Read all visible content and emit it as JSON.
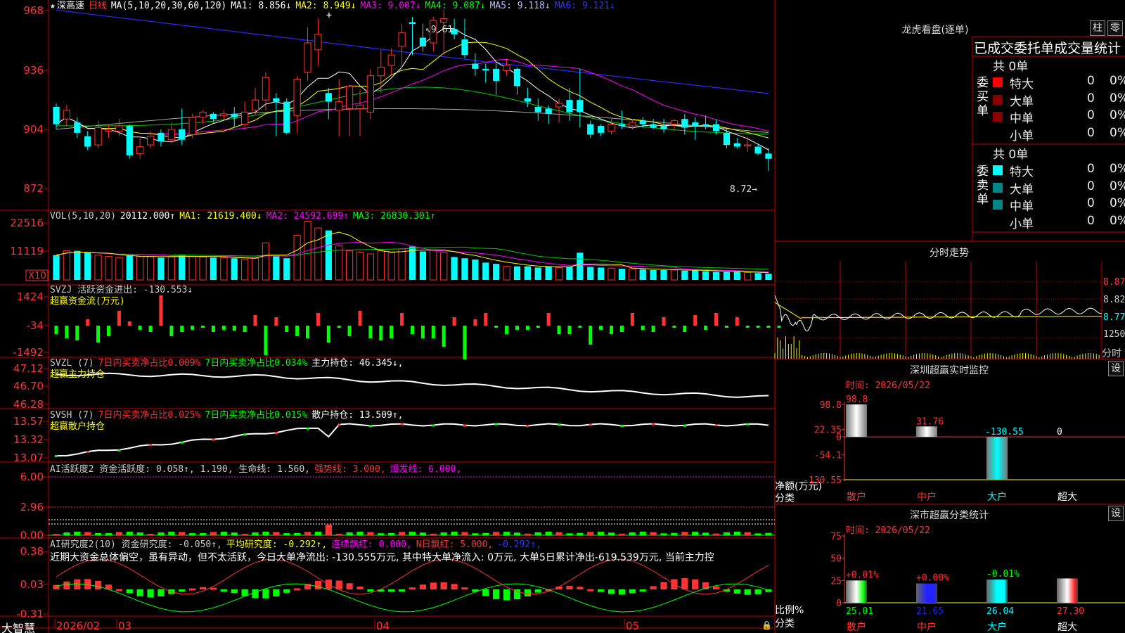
{
  "colors": {
    "up": "#ff3333",
    "down": "#00ffff",
    "grid": "#cc0000",
    "ma1": "#ffffff",
    "ma2": "#ffff00",
    "ma3": "#ff00ff",
    "ma4": "#00ff00",
    "ma5": "#8888ff",
    "ma6": "#3333ff",
    "axisText": "#ff3333",
    "yellow": "#ffff00",
    "green": "#00ff00",
    "white": "#ffffff",
    "cyan": "#00ffff"
  },
  "icons": {
    "star": "star-icon",
    "lock": "lock-icon"
  },
  "main": {
    "stock": "深高速",
    "period": "日线",
    "ma_label": "MA(5,10,20,30,60,120)",
    "ma1": "MA1: 8.856↓",
    "ma2": "MA2: 8.949↓",
    "ma3": "MA3: 9.007↓",
    "ma4": "MA4: 9.087↓",
    "ma5": "MA5: 9.118↓",
    "ma6": "MA6: 9.121↓",
    "high_label": "9.61",
    "low_label": "8.72",
    "yticks": [
      "968",
      "936",
      "904",
      "872"
    ]
  },
  "vol": {
    "label": "VOL(5,10,20)",
    "value": "20112.000↑",
    "ma1": "MA1: 21619.400↓",
    "ma2": "MA2: 24592.699↑",
    "ma3": "MA3: 26830.301↑",
    "yticks": [
      "22516",
      "11119"
    ],
    "unit": "X10"
  },
  "svzj": {
    "label": "SVZJ 活跃资金进出: -130.553↓",
    "sub": "超赢资金流(万元)",
    "yticks": [
      "1424",
      "-34",
      "-1492"
    ]
  },
  "svzl": {
    "label": "SVZL (7)",
    "p1": "7日内买卖净占比0.009%",
    "p2": "7日内买卖净占比0.034%",
    "p3": "主力持仓: 46.345↓,",
    "sub": "超赢主力持仓",
    "yticks": [
      "47.12",
      "46.70",
      "46.28"
    ]
  },
  "svsh": {
    "label": "SVSH (7)",
    "p1": "7日内买卖净占比0.025%",
    "p2": "7日内买卖净占比0.015%",
    "p3": "散户持仓: 13.509↑,",
    "sub": "超赢散户持仓",
    "yticks": [
      "13.57",
      "13.32",
      "13.07"
    ]
  },
  "ai1": {
    "label": "AI活跃度2 资金活跃度: 0.058↑, 1.190, 生命线: 1.560,",
    "p2": "强势线: 3.000,",
    "p3": "爆发线: 6.000,",
    "yticks": [
      "6.00",
      "2.96",
      "0.00"
    ]
  },
  "ai2": {
    "label": "AI研究度2(10) 资金研究度: -0.050↑,",
    "p2": "平均研究度: -0.292↑,",
    "p3": "连续飘红: 0.000,",
    "p4": "N日飘红: 5.000,",
    "p5": "-0.292↑,",
    "comment": "近期大资金总体偏空，虽有异动，但不太活跃，今日大单净流出: -130.555万元, 其中特大单净流入: 0万元, 大单5日累计净出-619.539万元, 当前主力控",
    "yticks": [
      "0.38",
      "0.03",
      "-0.31"
    ]
  },
  "bottom": {
    "brand": "大智慧",
    "dates": [
      "2026/02",
      "03",
      "04",
      "05"
    ]
  },
  "longhu": {
    "title": "龙虎看盘(逐单)",
    "btn1": "柱",
    "btn2": "零",
    "tabs": "已成交委托单成交量统计",
    "buy": {
      "side": "委买单",
      "total": "共 0单",
      "rows": [
        {
          "name": "特大",
          "v": "0",
          "p": "0%"
        },
        {
          "name": "大单",
          "v": "0",
          "p": "0%"
        },
        {
          "name": "中单",
          "v": "0",
          "p": "0%"
        },
        {
          "name": "小单",
          "v": "0",
          "p": "0%"
        }
      ]
    },
    "sell": {
      "side": "委卖单",
      "total": "共 0单",
      "rows": [
        {
          "name": "特大",
          "v": "0",
          "p": "0%"
        },
        {
          "name": "大单",
          "v": "0",
          "p": "0%"
        },
        {
          "name": "中单",
          "v": "0",
          "p": "0%"
        },
        {
          "name": "小单",
          "v": "0",
          "p": "0%"
        }
      ]
    }
  },
  "intraday": {
    "title": "分时走势",
    "yticks": [
      "8.87",
      "8.82",
      "8.77"
    ],
    "vol": "1250",
    "unit": "分时"
  },
  "monitor": {
    "title": "深圳超赢实时监控",
    "btn": "设",
    "date": "时间: 2026/05/22",
    "ylabel": "净额(万元)",
    "xlabel": "分类",
    "yticks": [
      "98.8",
      "22.35",
      "0",
      "-54.1",
      "-130.55"
    ],
    "chart_data": {
      "type": "bar",
      "categories": [
        "散户",
        "中户",
        "大户",
        "超大"
      ],
      "values": [
        98.8,
        31.76,
        -130.55,
        0
      ],
      "labels": [
        "98.8",
        "31.76",
        "-130.55",
        "0"
      ],
      "ylim": [
        -130.55,
        98.8
      ]
    }
  },
  "classify": {
    "title": "深市超赢分类统计",
    "btn": "设",
    "date": "时间: 2026/05/22",
    "ylabel": "比例%",
    "xlabel": "分类",
    "yticks": [
      "75",
      "50",
      "25",
      "0"
    ],
    "chart_data": {
      "type": "bar",
      "categories": [
        "散户",
        "中户",
        "大户",
        "超大"
      ],
      "values": [
        25.01,
        21.65,
        26.04,
        27.3
      ],
      "changes": [
        "+0.01%",
        "+0.00%",
        "-0.01%",
        ""
      ],
      "labels": [
        "25.01",
        "21.65",
        "26.04",
        "27.30"
      ],
      "ylim": [
        0,
        75
      ]
    }
  },
  "chart_data": {
    "type": "candlestick",
    "ylim": [
      8.62,
      9.71
    ],
    "candles": [
      [
        9.1,
        9.0,
        9.12,
        8.97
      ],
      [
        9.03,
        9.08,
        9.11,
        8.99
      ],
      [
        9.01,
        8.95,
        9.04,
        8.92
      ],
      [
        8.93,
        8.87,
        8.96,
        8.85
      ],
      [
        8.88,
        8.98,
        9.02,
        8.86
      ],
      [
        8.96,
        8.97,
        9.0,
        8.92
      ],
      [
        8.96,
        8.99,
        9.03,
        8.93
      ],
      [
        8.99,
        8.82,
        9.0,
        8.8
      ],
      [
        8.83,
        8.87,
        8.93,
        8.8
      ],
      [
        8.88,
        8.93,
        8.96,
        8.86
      ],
      [
        8.95,
        8.9,
        8.97,
        8.87
      ],
      [
        8.91,
        8.97,
        9.01,
        8.89
      ],
      [
        8.97,
        8.91,
        9.09,
        8.88
      ],
      [
        8.94,
        9.04,
        9.06,
        8.92
      ],
      [
        9.04,
        9.07,
        9.08,
        9.0
      ],
      [
        9.06,
        9.03,
        9.07,
        9.01
      ],
      [
        9.05,
        9.06,
        9.08,
        9.02
      ],
      [
        9.06,
        9.04,
        9.1,
        8.98
      ],
      [
        9.0,
        9.07,
        9.13,
        8.97
      ],
      [
        9.08,
        9.14,
        9.21,
        9.05
      ],
      [
        9.14,
        9.27,
        9.3,
        9.08
      ],
      [
        9.15,
        9.13,
        9.18,
        8.93
      ],
      [
        9.13,
        8.95,
        9.15,
        8.94
      ],
      [
        9.05,
        9.26,
        9.28,
        8.95
      ],
      [
        9.3,
        9.47,
        9.56,
        9.25
      ],
      [
        9.43,
        9.52,
        9.61,
        9.34
      ],
      [
        9.18,
        9.13,
        9.21,
        9.03
      ],
      [
        9.08,
        9.13,
        9.26,
        8.93
      ],
      [
        9.09,
        9.22,
        9.22,
        8.93
      ],
      [
        9.09,
        9.11,
        9.2,
        8.93
      ],
      [
        9.07,
        9.28,
        9.32,
        9.03
      ],
      [
        9.28,
        9.33,
        9.43,
        9.18
      ],
      [
        9.34,
        9.4,
        9.44,
        9.28
      ],
      [
        9.45,
        9.53,
        9.58,
        9.33
      ],
      [
        9.59,
        9.58,
        9.62,
        9.4
      ],
      [
        9.5,
        9.45,
        9.58,
        9.42
      ],
      [
        9.47,
        9.6,
        9.62,
        9.42
      ],
      [
        9.59,
        9.61,
        9.66,
        9.4
      ],
      [
        9.55,
        9.52,
        9.61,
        9.49
      ],
      [
        9.49,
        9.4,
        9.61,
        9.38
      ],
      [
        9.35,
        9.32,
        9.41,
        9.28
      ],
      [
        9.32,
        9.31,
        9.35,
        9.24
      ],
      [
        9.32,
        9.25,
        9.35,
        9.17
      ],
      [
        9.31,
        9.34,
        9.38,
        9.28
      ],
      [
        9.32,
        9.22,
        9.33,
        9.17
      ],
      [
        9.15,
        9.13,
        9.21,
        9.1
      ],
      [
        9.1,
        9.07,
        9.15,
        9.02
      ],
      [
        9.09,
        9.06,
        9.11,
        9.0
      ],
      [
        9.1,
        9.12,
        9.15,
        9.01
      ],
      [
        9.14,
        9.07,
        9.21,
        9.02
      ],
      [
        9.14,
        9.07,
        9.32,
        8.98
      ],
      [
        9.0,
        8.94,
        9.02,
        8.92
      ],
      [
        8.99,
        8.95,
        9.0,
        8.93
      ],
      [
        8.96,
        9.0,
        9.03,
        8.94
      ],
      [
        9.0,
        8.99,
        9.08,
        8.97
      ],
      [
        8.99,
        9.01,
        9.03,
        8.97
      ],
      [
        9.02,
        9.0,
        9.04,
        8.98
      ],
      [
        9.0,
        8.98,
        9.03,
        8.97
      ],
      [
        8.99,
        8.97,
        9.03,
        8.95
      ],
      [
        9.0,
        9.02,
        9.03,
        8.96
      ],
      [
        9.03,
        8.98,
        9.06,
        8.94
      ],
      [
        9.01,
        8.99,
        9.04,
        8.91
      ],
      [
        9.0,
        8.99,
        9.05,
        8.97
      ],
      [
        9.0,
        8.96,
        9.03,
        8.94
      ],
      [
        8.95,
        8.88,
        8.98,
        8.86
      ],
      [
        8.89,
        8.87,
        8.92,
        8.86
      ],
      [
        8.88,
        8.88,
        8.93,
        8.84
      ],
      [
        8.87,
        8.83,
        8.88,
        8.82
      ],
      [
        8.83,
        8.8,
        8.86,
        8.73
      ]
    ],
    "volume": [
      0.4,
      0.47,
      0.47,
      0.44,
      0.4,
      0.38,
      0.36,
      0.4,
      0.38,
      0.38,
      0.36,
      0.37,
      0.41,
      0.38,
      0.37,
      0.36,
      0.36,
      0.35,
      0.33,
      0.35,
      0.6,
      0.38,
      0.35,
      0.72,
      0.95,
      0.84,
      0.8,
      0.55,
      0.47,
      0.45,
      0.42,
      0.47,
      0.44,
      0.5,
      0.54,
      0.46,
      0.48,
      0.44,
      0.37,
      0.35,
      0.33,
      0.28,
      0.26,
      0.22,
      0.22,
      0.22,
      0.2,
      0.22,
      0.2,
      0.21,
      0.44,
      0.21,
      0.2,
      0.19,
      0.18,
      0.18,
      0.17,
      0.16,
      0.16,
      0.16,
      0.15,
      0.16,
      0.14,
      0.13,
      0.13,
      0.13,
      0.12,
      0.11,
      0.1
    ],
    "svzj": [
      -0.2,
      -0.3,
      -0.35,
      0.15,
      -0.4,
      -0.25,
      0.35,
      0.1,
      -0.1,
      -0.15,
      -0.2,
      -0.25,
      -0.15,
      -0.1,
      -0.05,
      -0.15,
      -0.1,
      -0.12,
      -0.15,
      0.25,
      -0.7,
      0.2,
      -0.15,
      -0.25,
      -0.3,
      0.3,
      -0.4,
      -0.05,
      -0.25,
      0.35,
      -0.3,
      -0.35,
      -0.3,
      0.3,
      -0.2,
      -0.3,
      -0.3,
      -0.5,
      0.2,
      -0.8,
      0.15,
      0.3,
      -0.05,
      -0.2,
      -0.1,
      -0.1,
      -0.05,
      0.3,
      -0.2,
      -0.2,
      -0.05,
      -0.45,
      -0.1,
      -0.2,
      -0.15,
      0.3,
      -0.1,
      -0.15,
      0.2,
      -0.05,
      -0.15,
      0.25,
      -0.1,
      0.3,
      -0.05,
      0.2,
      -0.05,
      -0.05,
      -0.05,
      -0.05
    ]
  }
}
